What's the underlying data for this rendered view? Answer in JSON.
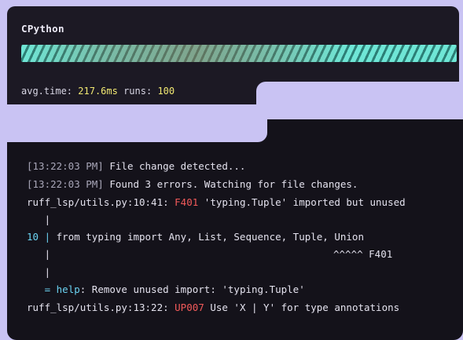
{
  "benchmark": {
    "title": "CPython",
    "progress": 1.0,
    "avg_time_label": "avg.time:",
    "avg_time_value": "217.6ms",
    "runs_label": "runs:",
    "runs_value": "100"
  },
  "terminal": {
    "lines": [
      {
        "ts": "[13:22:03 PM]",
        "text": " File change detected..."
      },
      {
        "ts": "[13:22:03 PM]",
        "text": " Found 3 errors. Watching for file changes."
      }
    ],
    "error1": {
      "location": "ruff_lsp/utils.py:10:41: ",
      "code": "F401",
      "message": " 'typing.Tuple' imported but unused"
    },
    "pipe_line_1": "   |",
    "source_line_no": "10",
    "source_line_sep": " | ",
    "source_line_text": "from typing import Any, List, Sequence, Tuple, Union",
    "pipe_line_2": "   |",
    "caret_marker": "^^^^^ F401",
    "pipe_line_3": "   |",
    "help_prefix": "   = ",
    "help_label": "help",
    "help_text": ": Remove unused import: 'typing.Tuple'",
    "error2": {
      "location": "ruff_lsp/utils.py:13:22: ",
      "code": "UP007",
      "message": " Use 'X | Y' for type annotations"
    }
  }
}
